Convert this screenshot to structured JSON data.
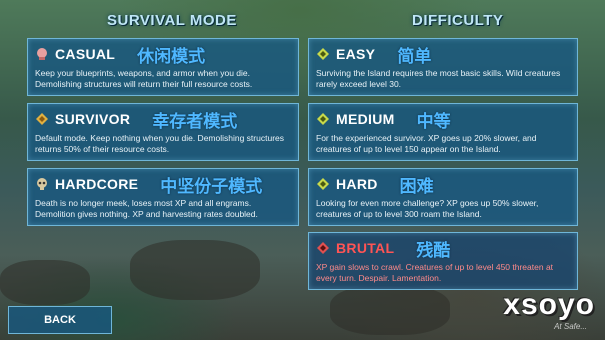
{
  "headers": {
    "survival_mode": "SURVIVAL MODE",
    "difficulty": "DIFFICULTY"
  },
  "survival_modes": [
    {
      "name": "CASUAL",
      "cn": "休闲模式",
      "icon": "casual-helmet-icon",
      "desc": "Keep your blueprints, weapons, and armor when you die. Demolishing structures will return their full resource costs."
    },
    {
      "name": "SURVIVOR",
      "cn": "幸存者模式",
      "icon": "survivor-badge-icon",
      "desc": "Default mode. Keep nothing when you die. Demolishing structures returns 50% of their resource costs."
    },
    {
      "name": "HARDCORE",
      "cn": "中坚份子模式",
      "icon": "hardcore-skull-icon",
      "desc": "Death is no longer meek, loses most XP and all engrams. Demolition gives nothing. XP and harvesting rates doubled."
    }
  ],
  "difficulties": [
    {
      "name": "EASY",
      "cn": "简单",
      "icon": "easy-diamond-icon",
      "desc": "Surviving the Island requires the most basic skills. Wild creatures rarely exceed level 30."
    },
    {
      "name": "MEDIUM",
      "cn": "中等",
      "icon": "medium-diamond-icon",
      "desc": "For the experienced survivor. XP goes up 20% slower, and creatures of up to level 150 appear on the Island."
    },
    {
      "name": "HARD",
      "cn": "困难",
      "icon": "hard-diamond-icon",
      "desc": "Looking for even more challenge? XP goes up 50% slower, creatures of up to level 300 roam the Island."
    },
    {
      "name": "BRUTAL",
      "cn": "残酷",
      "icon": "brutal-diamond-icon",
      "desc": "XP gain slows to crawl. Creatures of up to level 450 threaten at every turn. Despair. Lamentation."
    }
  ],
  "back_label": "BACK",
  "watermark": "xsoyo",
  "watermark_sub": "At Safe...",
  "colors": {
    "panel": "#185880",
    "panel_border": "#6fb6d8",
    "cn_text": "#4fb8ff",
    "brutal": "#ff5454",
    "diamond_icon": "#c8d94a"
  }
}
